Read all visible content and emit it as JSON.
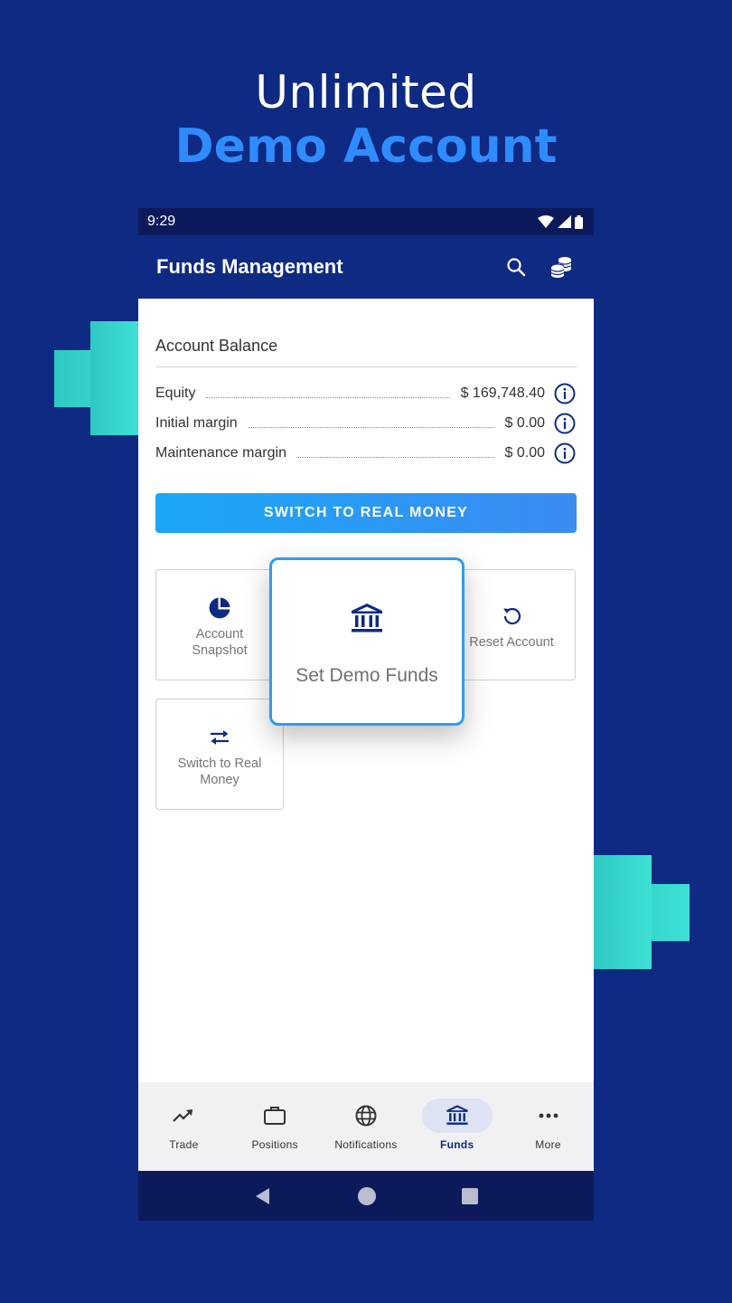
{
  "promo": {
    "line1": "Unlimited",
    "line2": "Demo Account"
  },
  "status_bar": {
    "time": "9:29",
    "icons": [
      "wifi-icon",
      "signal-icon",
      "battery-icon"
    ]
  },
  "app_bar": {
    "title": "Funds Management",
    "actions": [
      "search-icon",
      "coins-icon"
    ]
  },
  "account": {
    "section_title": "Account Balance",
    "rows": [
      {
        "label": "Equity",
        "value": "$ 169,748.40"
      },
      {
        "label": "Initial margin",
        "value": "$ 0.00"
      },
      {
        "label": "Maintenance margin",
        "value": "$ 0.00"
      }
    ]
  },
  "switch_button": {
    "label": "SWITCH TO REAL MONEY"
  },
  "tiles": {
    "snapshot": {
      "label_line1": "Account",
      "label_line2": "Snapshot",
      "icon": "pie-chart-icon"
    },
    "demo_funds": {
      "label": "Set Demo Funds",
      "icon": "bank-icon"
    },
    "reset": {
      "label": "Reset Account",
      "icon": "reset-icon"
    },
    "switch_real": {
      "label_line1": "Switch to Real",
      "label_line2": "Money",
      "icon": "swap-arrows-icon"
    }
  },
  "bottom_nav": {
    "items": [
      {
        "label": "Trade",
        "icon": "trending-up-icon",
        "active": false
      },
      {
        "label": "Positions",
        "icon": "briefcase-icon",
        "active": false
      },
      {
        "label": "Notifications",
        "icon": "globe-icon",
        "active": false
      },
      {
        "label": "Funds",
        "icon": "bank-icon",
        "active": true
      },
      {
        "label": "More",
        "icon": "more-dots-icon",
        "active": false
      }
    ]
  },
  "colors": {
    "background": "#0e2a83",
    "accent_blue": "#2f8cff",
    "teal": "#3ee0d6",
    "nav_dark": "#0c1a5c",
    "icon_navy": "#0e2a83"
  }
}
